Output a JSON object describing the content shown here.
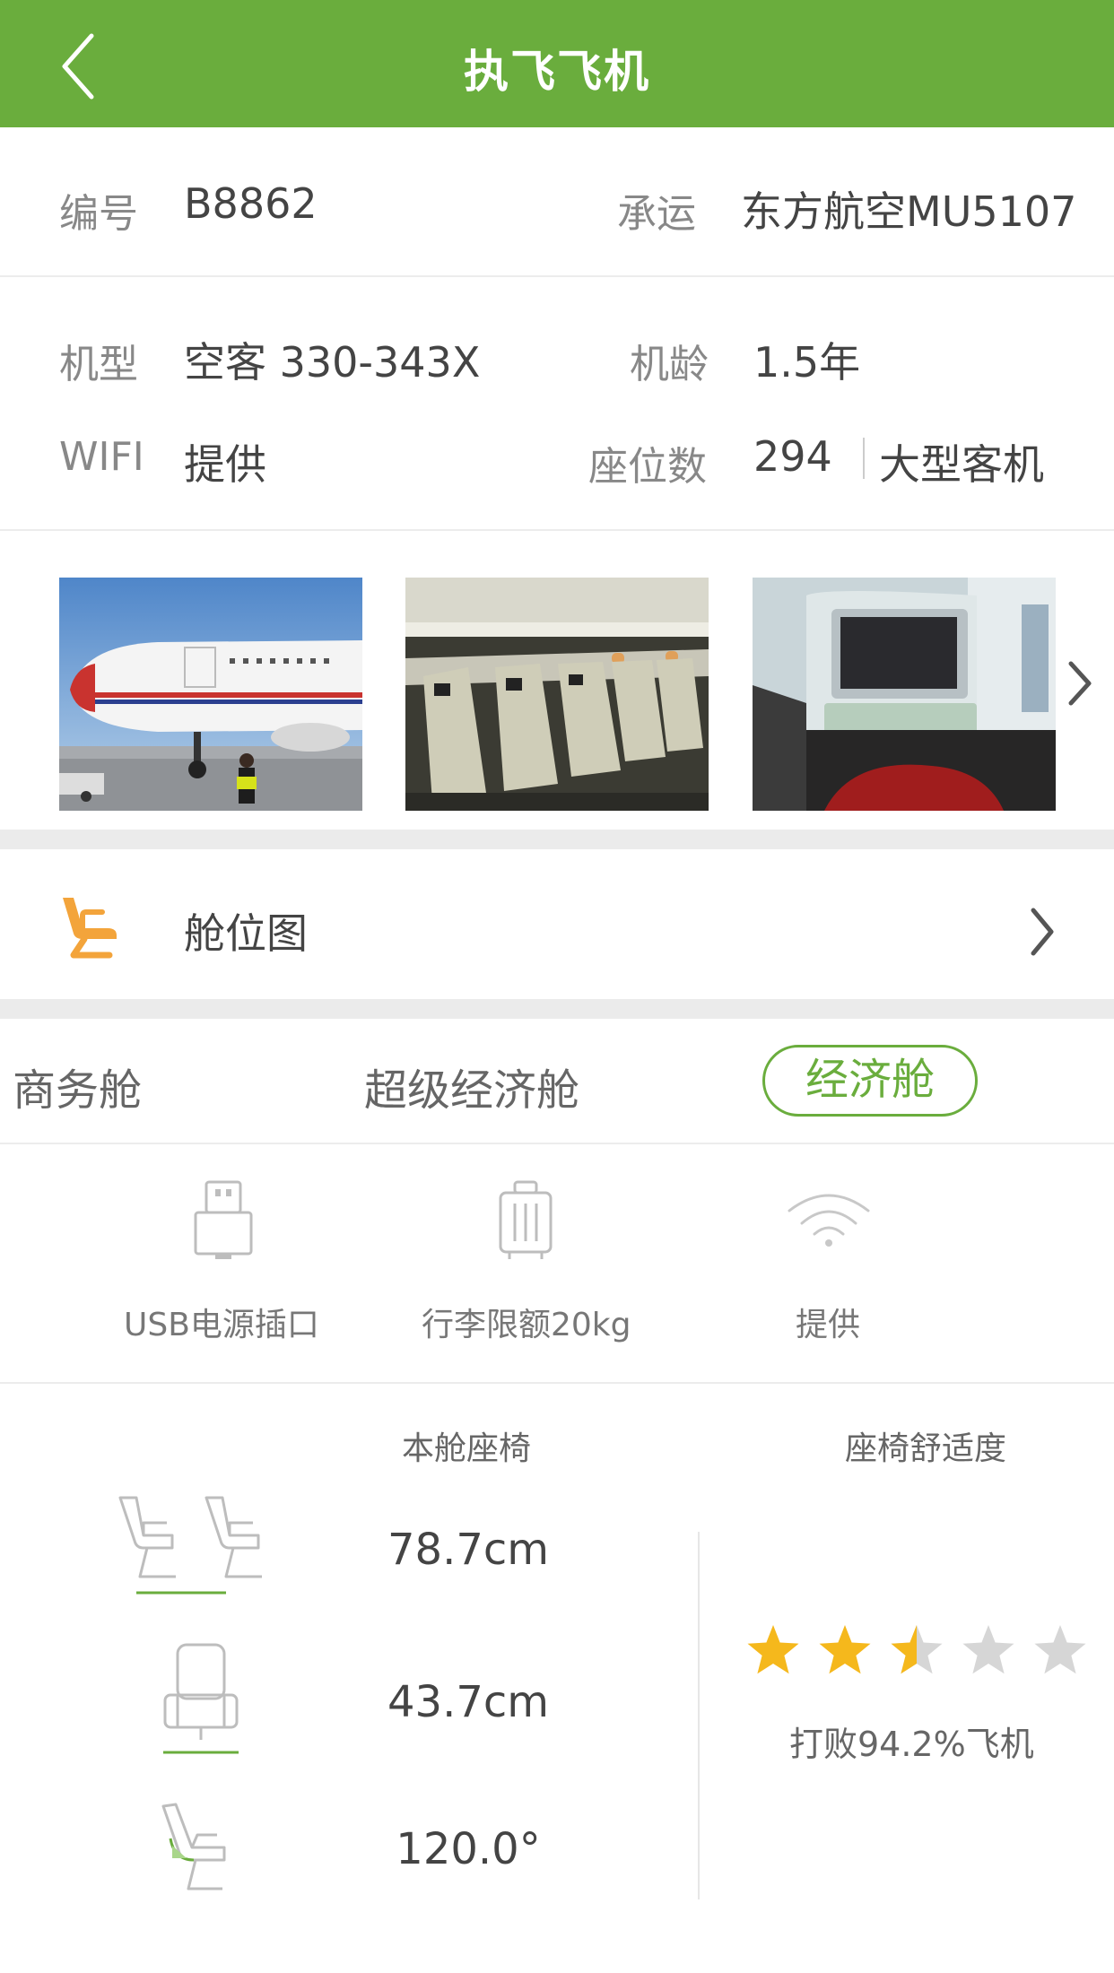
{
  "nav": {
    "title": "执飞飞机"
  },
  "info": {
    "number_label": "编号",
    "number_value": "B8862",
    "carrier_label": "承运",
    "carrier_value": "东方航空MU5107",
    "model_label": "机型",
    "model_value": "空客 330-343X",
    "age_label": "机龄",
    "age_value": "1.5年",
    "wifi_label": "WIFI",
    "wifi_value": "提供",
    "seats_label": "座位数",
    "seats_value": "294",
    "size_value": "大型客机"
  },
  "cabin_map": {
    "label": "舱位图"
  },
  "cabin_tabs": [
    "商务舱",
    "超级经济舱",
    "经济舱"
  ],
  "active_tab_index": 2,
  "amenities": [
    {
      "label": "USB电源插口",
      "icon": "usb-icon"
    },
    {
      "label": "行李限额20kg",
      "icon": "luggage-icon"
    },
    {
      "label": "提供",
      "icon": "wifi-icon"
    }
  ],
  "seat_section": {
    "column_header": "本舱座椅",
    "comfort_header": "座椅舒适度",
    "seat_pitch": "78.7cm",
    "seat_width": "43.7cm",
    "recline": "120.0°",
    "rating_stars": 2.5,
    "rating_max": 5,
    "beat_text": "打败94.2%飞机"
  },
  "colors": {
    "brand_green": "#6aad3d",
    "star_gold": "#f5b81c",
    "star_gray": "#d6d6d6",
    "seat_orange": "#f3a43b"
  }
}
